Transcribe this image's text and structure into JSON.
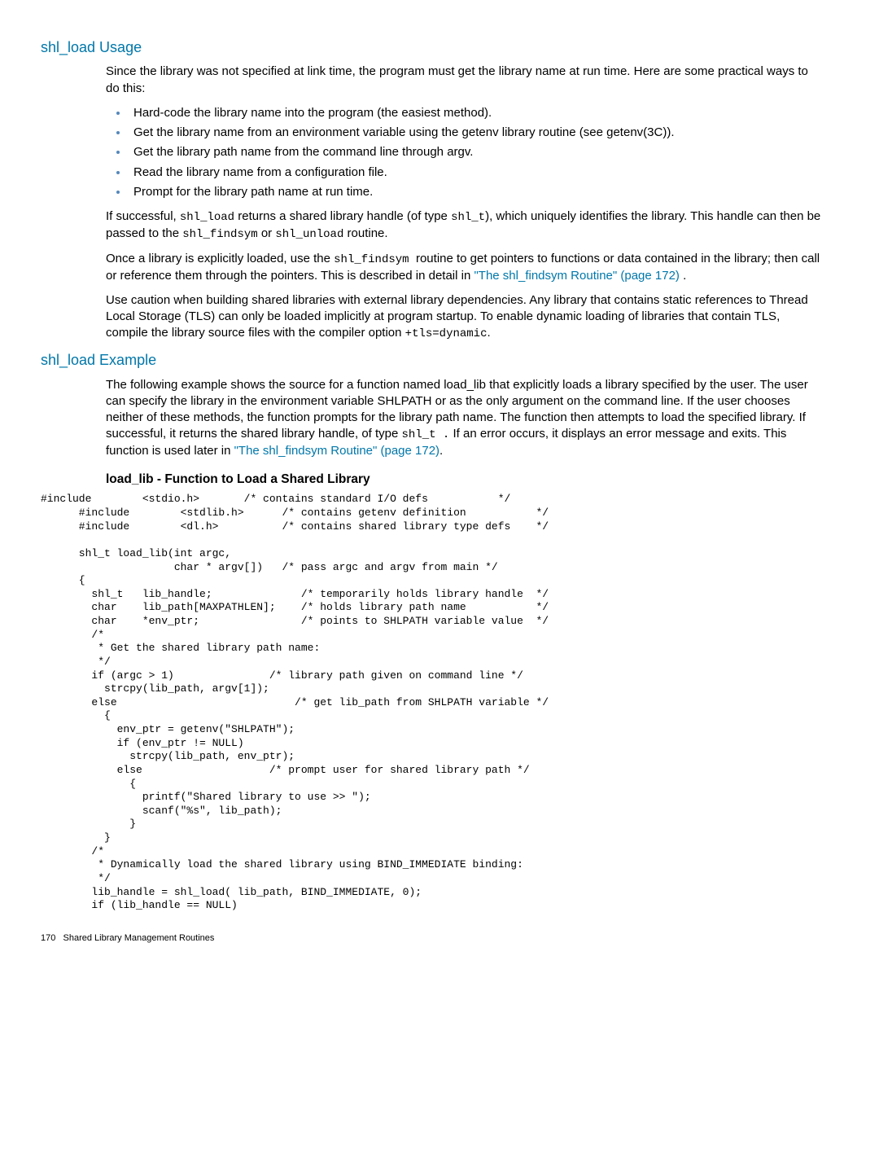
{
  "sections": {
    "usage": {
      "heading": "shl_load Usage",
      "p1a": "Since the library was not specified at link time, the program must get the library name at run time. Here are some practical ways to do this:",
      "bullets": [
        "Hard-code the library name into the program (the easiest method).",
        "Get the library name from an environment variable using the getenv library routine (see getenv(3C)).",
        "Get the library path name from the command line through argv.",
        "Read the library name from a configuration file.",
        "Prompt for the library path name at run time."
      ],
      "p2_pre": "If successful, ",
      "p2_c1": "shl_load",
      "p2_mid1": " returns a shared library handle (of type ",
      "p2_c2": "shl_t",
      "p2_mid2": "), which uniquely identifies the library. This handle can then be passed to the ",
      "p2_c3": "shl_findsym",
      "p2_mid3": " or ",
      "p2_c4": "shl_unload",
      "p2_end": " routine.",
      "p3_pre": "Once a library is explicitly loaded, use the ",
      "p3_c1": "shl_findsym ",
      "p3_mid1": " routine to get pointers to functions or data contained in the library; then call or reference them through the pointers. This is described in detail in ",
      "p3_link": "\"The shl_findsym Routine\" (page 172)",
      "p3_end": " .",
      "p4_pre": "Use caution when building shared libraries with external library dependencies. Any library that contains static references to Thread Local Storage (TLS) can only be loaded implicitly at program startup. To enable dynamic loading of libraries that contain TLS, compile the library source files with the compiler option ",
      "p4_c1": "+tls=dynamic",
      "p4_end": "."
    },
    "example": {
      "heading": "shl_load Example",
      "p1_pre": "The following example shows the source for a function named load_lib that explicitly loads a library specified by the user. The user can specify the library in the environment variable SHLPATH or as the only argument on the command line. If the user chooses neither of these methods, the function prompts for the library path name. The function then attempts to load the specified library. If successful, it returns the shared library handle, of type ",
      "p1_c1": "shl_t .",
      "p1_mid": " If an error occurs, it displays an error message and exits. This function is used later in ",
      "p1_link": "\"The shl_findsym Routine\" (page 172)",
      "p1_end": ".",
      "subhead": "load_lib - Function to Load a Shared Library",
      "code": "#include        <stdio.h>       /* contains standard I/O defs           */\n      #include        <stdlib.h>      /* contains getenv definition           */\n      #include        <dl.h>          /* contains shared library type defs    */\n\n      shl_t load_lib(int argc,\n                     char * argv[])   /* pass argc and argv from main */\n      {\n        shl_t   lib_handle;              /* temporarily holds library handle  */\n        char    lib_path[MAXPATHLEN];    /* holds library path name           */\n        char    *env_ptr;                /* points to SHLPATH variable value  */\n        /*\n         * Get the shared library path name:\n         */\n        if (argc > 1)               /* library path given on command line */\n          strcpy(lib_path, argv[1]);\n        else                            /* get lib_path from SHLPATH variable */\n          {\n            env_ptr = getenv(\"SHLPATH\");\n            if (env_ptr != NULL)\n              strcpy(lib_path, env_ptr);\n            else                    /* prompt user for shared library path */\n              {\n                printf(\"Shared library to use >> \");\n                scanf(\"%s\", lib_path);\n              }\n          }\n        /*\n         * Dynamically load the shared library using BIND_IMMEDIATE binding:\n         */\n        lib_handle = shl_load( lib_path, BIND_IMMEDIATE, 0);\n        if (lib_handle == NULL)"
    }
  },
  "footer": {
    "page_num": "170",
    "chapter": "Shared Library Management Routines"
  }
}
